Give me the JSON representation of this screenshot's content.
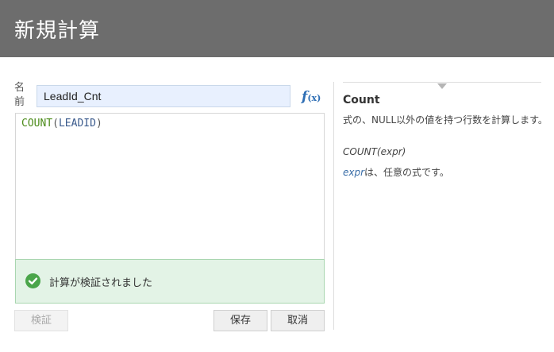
{
  "header": {
    "title": "新規計算"
  },
  "form": {
    "name_label": "名前",
    "name_value": "LeadId_Cnt",
    "fx_label": "f",
    "fx_suffix": "(x)"
  },
  "editor": {
    "tokens": [
      {
        "type": "function",
        "text": "COUNT"
      },
      {
        "type": "punct",
        "text": "("
      },
      {
        "type": "column",
        "text": "LEADID"
      },
      {
        "type": "punct",
        "text": ")"
      }
    ]
  },
  "status": {
    "message": "計算が検証されました",
    "icon": "check-circle-icon",
    "color": "#4aa54a"
  },
  "buttons": {
    "validate": "検証",
    "save": "保存",
    "cancel": "取消"
  },
  "help": {
    "title": "Count",
    "description": "式の、NULL以外の値を持つ行数を計算します。",
    "syntax": "COUNT(expr)",
    "arg_name": "expr",
    "arg_text": "は、任意の式です。"
  }
}
